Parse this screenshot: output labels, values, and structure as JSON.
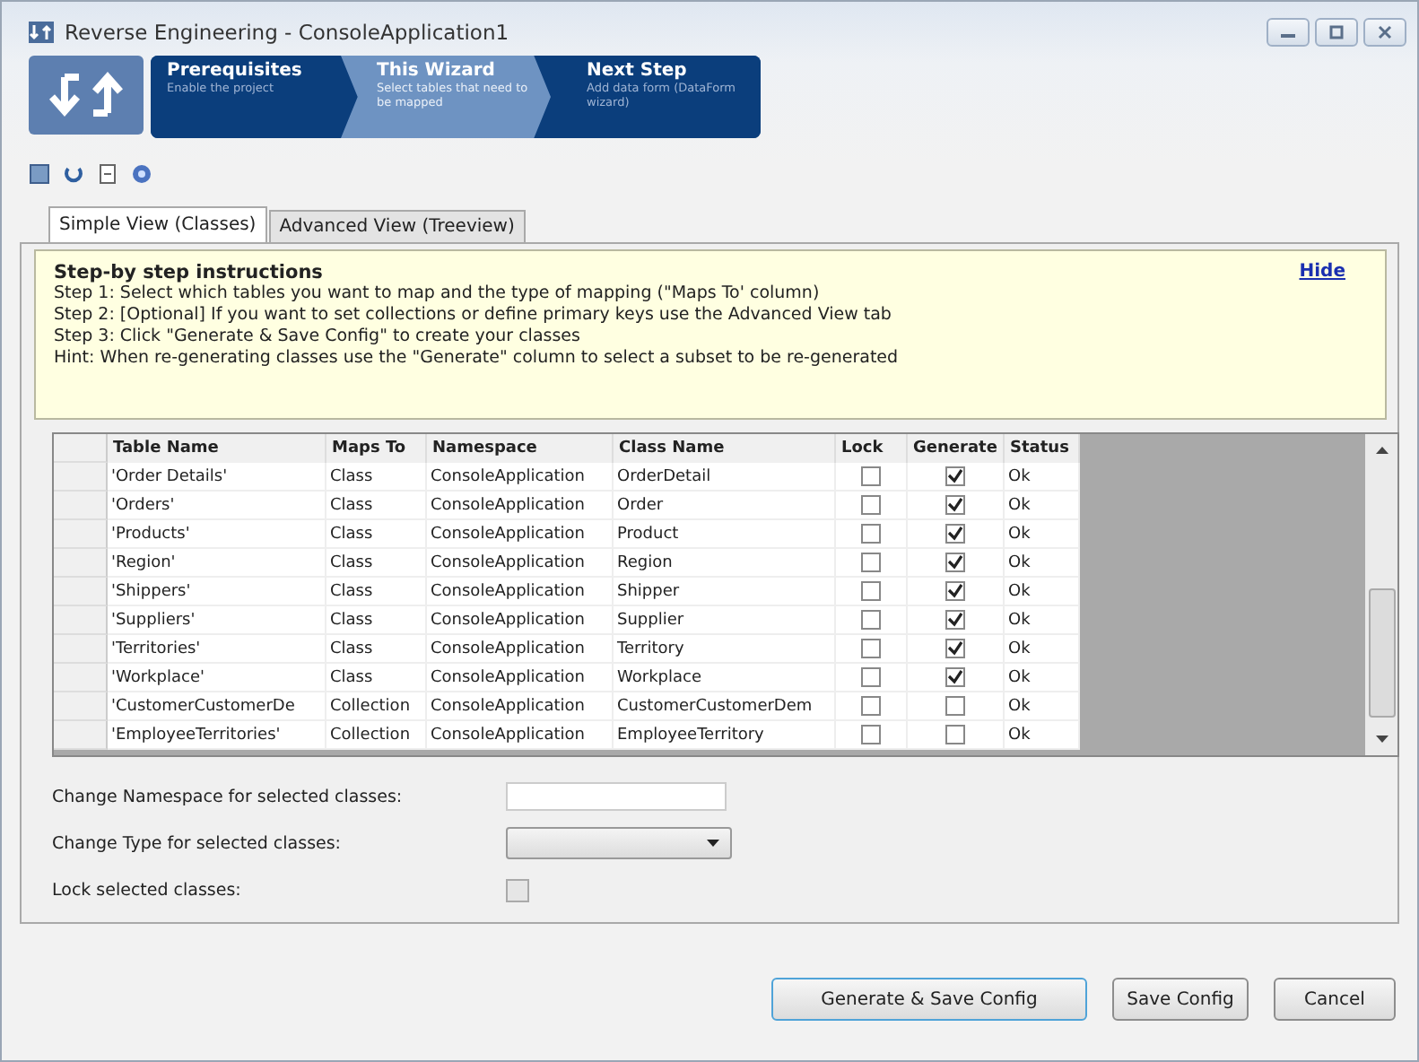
{
  "window": {
    "title": "Reverse Engineering - ConsoleApplication1"
  },
  "wizard_steps": [
    {
      "title": "Prerequisites",
      "subtitle": "Enable the project",
      "selected": false
    },
    {
      "title": "This Wizard",
      "subtitle": "Select tables that need to be mapped",
      "selected": true
    },
    {
      "title": "Next Step",
      "subtitle": "Add data form (DataForm wizard)",
      "selected": false
    }
  ],
  "tabs": [
    {
      "label": "Simple View (Classes)",
      "selected": true
    },
    {
      "label": "Advanced View (Treeview)",
      "selected": false
    }
  ],
  "instructions": {
    "heading": "Step-by step instructions",
    "lines": [
      "Step 1: Select which tables you want to map and the type of mapping (\"Maps To' column)",
      "Step 2: [Optional] If you want to set collections or define primary keys use the Advanced View tab",
      "Step 3: Click \"Generate & Save Config\" to create your classes",
      "Hint: When re-generating classes use the \"Generate\" column to select a subset to be re-generated"
    ],
    "hide_link": "Hide"
  },
  "table": {
    "columns": [
      "Table Name",
      "Maps To",
      "Namespace",
      "Class Name",
      "Lock",
      "Generate",
      "Status"
    ],
    "rows": [
      {
        "table_name": "'Order Details'",
        "maps_to": "Class",
        "namespace": "ConsoleApplication",
        "class_name": "OrderDetail",
        "lock": false,
        "generate": true,
        "status": "Ok"
      },
      {
        "table_name": "'Orders'",
        "maps_to": "Class",
        "namespace": "ConsoleApplication",
        "class_name": "Order",
        "lock": false,
        "generate": true,
        "status": "Ok"
      },
      {
        "table_name": "'Products'",
        "maps_to": "Class",
        "namespace": "ConsoleApplication",
        "class_name": "Product",
        "lock": false,
        "generate": true,
        "status": "Ok"
      },
      {
        "table_name": "'Region'",
        "maps_to": "Class",
        "namespace": "ConsoleApplication",
        "class_name": "Region",
        "lock": false,
        "generate": true,
        "status": "Ok"
      },
      {
        "table_name": "'Shippers'",
        "maps_to": "Class",
        "namespace": "ConsoleApplication",
        "class_name": "Shipper",
        "lock": false,
        "generate": true,
        "status": "Ok"
      },
      {
        "table_name": "'Suppliers'",
        "maps_to": "Class",
        "namespace": "ConsoleApplication",
        "class_name": "Supplier",
        "lock": false,
        "generate": true,
        "status": "Ok"
      },
      {
        "table_name": "'Territories'",
        "maps_to": "Class",
        "namespace": "ConsoleApplication",
        "class_name": "Territory",
        "lock": false,
        "generate": true,
        "status": "Ok"
      },
      {
        "table_name": "'Workplace'",
        "maps_to": "Class",
        "namespace": "ConsoleApplication",
        "class_name": "Workplace",
        "lock": false,
        "generate": true,
        "status": "Ok"
      },
      {
        "table_name": "'CustomerCustomerDe",
        "maps_to": "Collection",
        "namespace": "ConsoleApplication",
        "class_name": "CustomerCustomerDem",
        "lock": false,
        "generate": false,
        "status": "Ok"
      },
      {
        "table_name": "'EmployeeTerritories'",
        "maps_to": "Collection",
        "namespace": "ConsoleApplication",
        "class_name": "EmployeeTerritory",
        "lock": false,
        "generate": false,
        "status": "Ok"
      }
    ]
  },
  "form": {
    "namespace_label": "Change Namespace for selected classes:",
    "type_label": "Change Type for selected classes:",
    "lock_label": "Lock selected classes:",
    "lock_checked": false
  },
  "buttons": [
    "Generate & Save Config",
    "Save Config",
    "Cancel"
  ]
}
